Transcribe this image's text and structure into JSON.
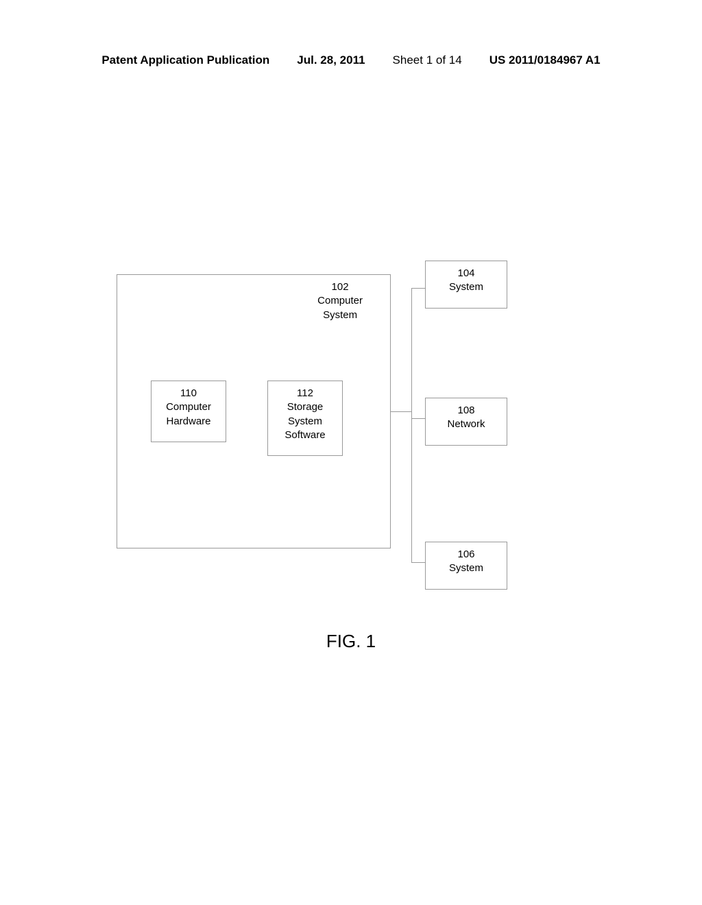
{
  "header": {
    "publication": "Patent Application Publication",
    "date": "Jul. 28, 2011",
    "sheet": "Sheet 1 of 14",
    "patent_number": "US 2011/0184967 A1"
  },
  "boxes": {
    "b102": {
      "num": "102",
      "label": "Computer\nSystem"
    },
    "b104": {
      "num": "104",
      "label": "System"
    },
    "b106": {
      "num": "106",
      "label": "System"
    },
    "b108": {
      "num": "108",
      "label": "Network"
    },
    "b110": {
      "num": "110",
      "label": "Computer\nHardware"
    },
    "b112": {
      "num": "112",
      "label": "Storage\nSystem\nSoftware"
    }
  },
  "figure_label": "FIG. 1"
}
